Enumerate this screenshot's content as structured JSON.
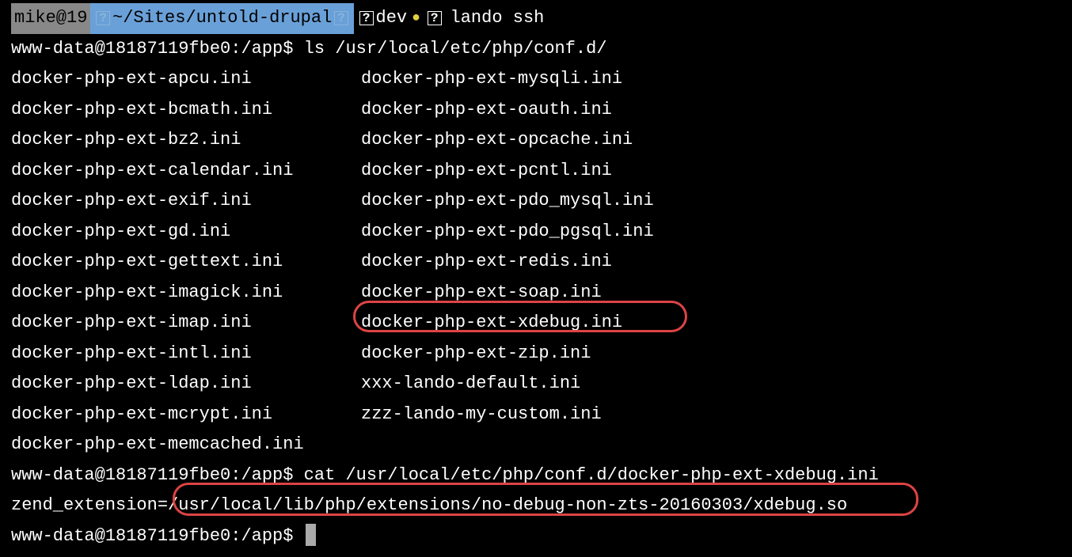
{
  "status": {
    "user_host": "mike@19",
    "path": "~/Sites/untold-drupal",
    "branch": "dev",
    "command": "lando ssh"
  },
  "lines": {
    "prompt1_user": "www-data@18187119fbe0:/app$",
    "prompt1_cmd": "ls /usr/local/etc/php/conf.d/",
    "prompt2_user": "www-data@18187119fbe0:/app$",
    "prompt2_cmd": "cat /usr/local/etc/php/conf.d/docker-php-ext-xdebug.ini",
    "zend_prefix": "zend_extension=",
    "zend_path": "/usr/local/lib/php/extensions/no-debug-non-zts-20160303/xdebug.so",
    "prompt3_user": "www-data@18187119fbe0:/app$"
  },
  "ls": {
    "col1": [
      "docker-php-ext-apcu.ini",
      "docker-php-ext-bcmath.ini",
      "docker-php-ext-bz2.ini",
      "docker-php-ext-calendar.ini",
      "docker-php-ext-exif.ini",
      "docker-php-ext-gd.ini",
      "docker-php-ext-gettext.ini",
      "docker-php-ext-imagick.ini",
      "docker-php-ext-imap.ini",
      "docker-php-ext-intl.ini",
      "docker-php-ext-ldap.ini",
      "docker-php-ext-mcrypt.ini",
      "docker-php-ext-memcached.ini"
    ],
    "col2": [
      "docker-php-ext-mysqli.ini",
      "docker-php-ext-oauth.ini",
      "docker-php-ext-opcache.ini",
      "docker-php-ext-pcntl.ini",
      "docker-php-ext-pdo_mysql.ini",
      "docker-php-ext-pdo_pgsql.ini",
      "docker-php-ext-redis.ini",
      "docker-php-ext-soap.ini",
      "docker-php-ext-xdebug.ini",
      "docker-php-ext-zip.ini",
      "xxx-lando-default.ini",
      "zzz-lando-my-custom.ini",
      ""
    ]
  }
}
